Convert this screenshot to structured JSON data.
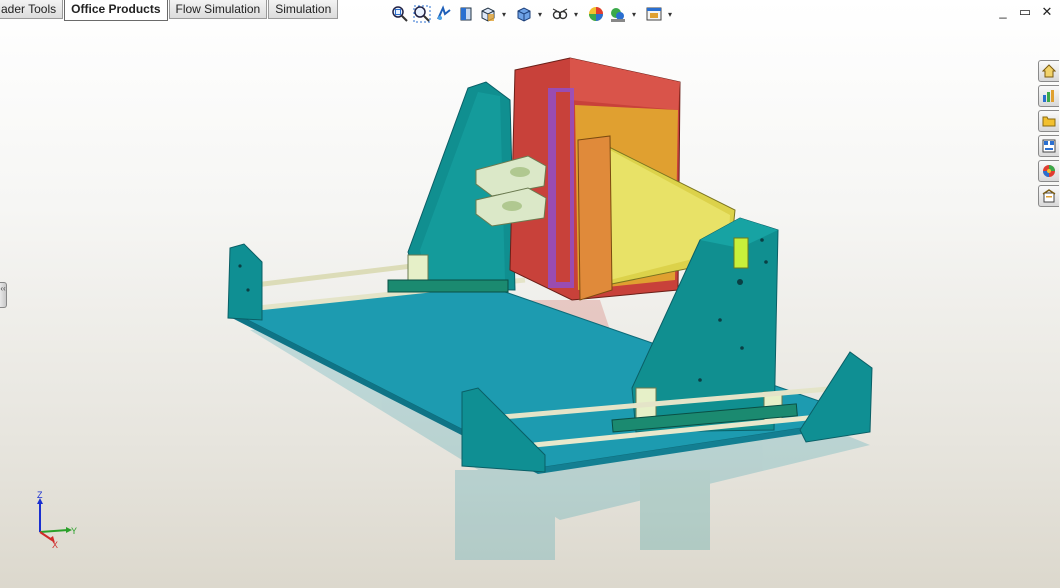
{
  "tabs": {
    "items": [
      "ader Tools",
      "Office Products",
      "Flow Simulation",
      "Simulation"
    ],
    "active": "Office Products"
  },
  "heads_up_toolbar": {
    "icons": [
      "zoom-to-fit-icon",
      "zoom-to-area-icon",
      "previous-view-icon",
      "section-view-icon",
      "view-orientation-icon",
      "display-style-icon",
      "hide-show-items-icon",
      "edit-appearance-icon",
      "apply-scene-icon",
      "view-settings-icon"
    ]
  },
  "window_controls": {
    "minimize": "_",
    "restore": "▭",
    "close": "✕"
  },
  "task_pane": {
    "icons": [
      "solidworks-resources-icon",
      "design-library-icon",
      "file-explorer-icon",
      "view-palette-icon",
      "appearances-scenes-icon",
      "custom-properties-icon"
    ]
  },
  "left_handle": {
    "glyph": "‹‹"
  },
  "triad": {
    "x": "X",
    "y": "Y",
    "z": "Z"
  },
  "colors": {
    "accent": "#0f8f93",
    "base": "#1b95a8",
    "gantry_red": "#c8413a",
    "rail": "#e4e4c8"
  }
}
